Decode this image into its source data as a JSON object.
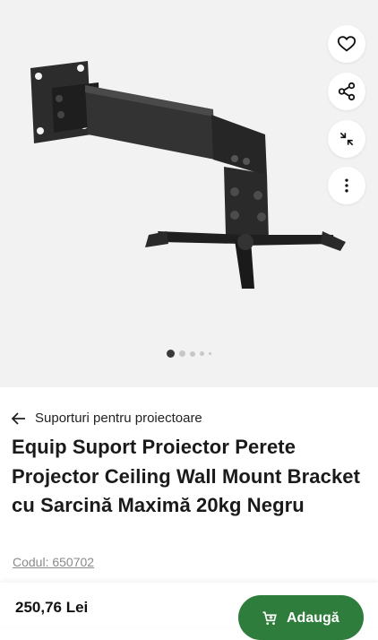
{
  "gallery": {
    "actions": [
      {
        "name": "heart-icon",
        "label": "favorite"
      },
      {
        "name": "share-icon",
        "label": "share"
      },
      {
        "name": "collapse-icon",
        "label": "collapse"
      },
      {
        "name": "more-vertical-icon",
        "label": "more"
      }
    ],
    "dots_total": 5,
    "active_dot": 1
  },
  "breadcrumb": {
    "icon": "arrow-left-icon",
    "label": "Suporturi pentru proiectoare"
  },
  "product": {
    "title": "Equip Suport Proiector Perete Projector Ceiling Wall Mount Bracket cu Sarcină Maximă 20kg Negru",
    "code": "Codul: 650702"
  },
  "footer": {
    "price": "250,76 Lei",
    "add_label": "Adaugă",
    "add_icon": "cart-plus-icon",
    "accent": "#2f7d3c"
  }
}
